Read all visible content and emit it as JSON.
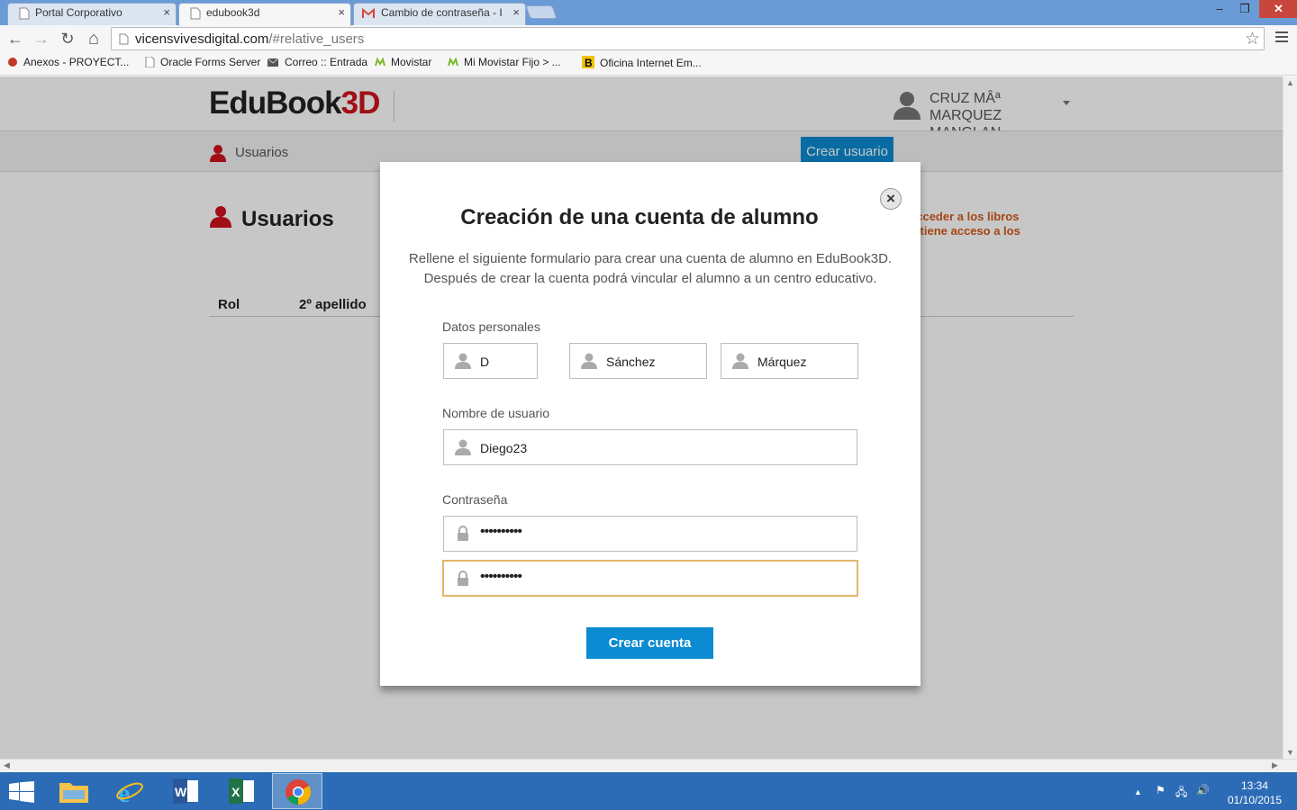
{
  "browser": {
    "tabs": [
      {
        "title": "Portal Corporativo",
        "close": "×"
      },
      {
        "title": "edubook3d",
        "close": "×"
      },
      {
        "title": "Cambio de contraseña - I",
        "close": "×"
      }
    ],
    "window_controls": {
      "minimize": "–",
      "maximize": "❐",
      "close": "✕"
    },
    "nav": {
      "back": "←",
      "forward": "→",
      "reload": "↻",
      "home": "⌂"
    },
    "url_host": "vicensvivesdigital.com",
    "url_path": "/#relative_users",
    "star": "☆",
    "bookmarks": [
      {
        "label": "Anexos - PROYECT...",
        "icon": "red-ball-icon",
        "color": "#c0392b"
      },
      {
        "label": "Oracle Forms Server",
        "icon": "page-icon",
        "color": "#ffffff"
      },
      {
        "label": "Correo :: Entrada",
        "icon": "envelope-icon",
        "color": "#555555"
      },
      {
        "label": "Movistar",
        "icon": "movistar-icon",
        "color": "#7ab82a"
      },
      {
        "label": "Mi Movistar Fijo > ...",
        "icon": "movistar-icon",
        "color": "#7ab82a"
      },
      {
        "label": "Oficina Internet Em...",
        "icon": "bank-b-icon",
        "color": "#f2c200"
      }
    ]
  },
  "site": {
    "logo_main": "EduBook",
    "logo_accent": "3D",
    "user_name": "CRUZ MÂª MARQUEZ MANGLAN...",
    "nav_label": "Usuarios",
    "create_user_label": "Crear usuario",
    "page_title": "Usuarios",
    "notice": "acceder a los libros\no tiene acceso a los",
    "columns": [
      "Rol",
      "2º apellido"
    ]
  },
  "modal": {
    "close": "×",
    "title": "Creación de una cuenta de alumno",
    "desc_line1": "Rellene el siguiente formulario para crear una cuenta de alumno en EduBook3D.",
    "desc_line2": "Después de crear la cuenta podrá vincular el alumno a un centro educativo.",
    "personal_label": "Datos personales",
    "first_name": "D",
    "last_name1": "Sánchez",
    "last_name2": "Márquez",
    "username_label": "Nombre de usuario",
    "username": "Diego23",
    "password_label": "Contraseña",
    "password_mask": "••••••••••",
    "password_confirm_mask": "••••••••••",
    "submit_label": "Crear cuenta"
  },
  "taskbar": {
    "clock_time": "13:34",
    "clock_date": "01/10/2015",
    "tray": [
      "▲",
      "⚑",
      "🖧",
      "🔊"
    ]
  },
  "colors": {
    "accent": "#0b8bd1",
    "brand_red": "#d0121d",
    "notice": "#d45a1c",
    "focus": "#e0b86a"
  }
}
